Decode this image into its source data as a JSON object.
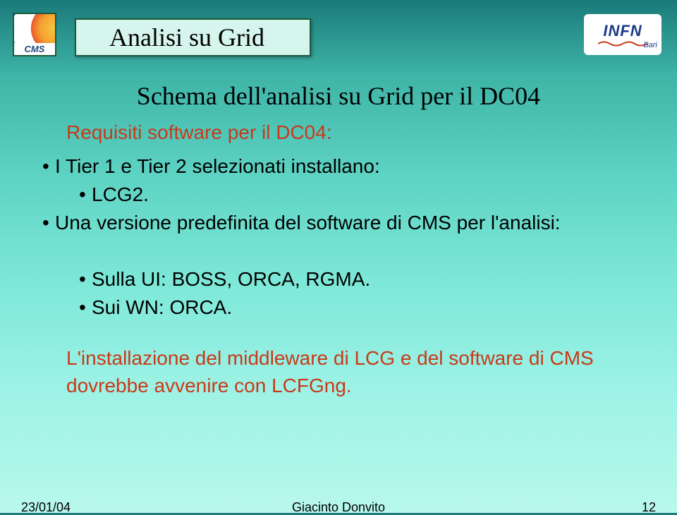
{
  "logos": {
    "cms": "CMS",
    "infn": "INFN",
    "infn_location": "Bari"
  },
  "title": "Analisi su Grid",
  "subtitle": "Schema dell'analisi su Grid per il DC04",
  "section_heading": "Requisiti software per il DC04:",
  "bullets": {
    "b1": "I Tier 1 e Tier 2 selezionati installano:",
    "s1": "LCG2.",
    "b2": "Una versione predefinita del software di CMS per l'analisi:",
    "s2": "Sulla UI: BOSS, ORCA, RGMA.",
    "s3": "Sui WN: ORCA."
  },
  "highlight": "L'installazione del middleware di LCG e del software di CMS dovrebbe avvenire con LCFGng.",
  "footer": {
    "date": "23/01/04",
    "author": "Giacinto Donvito",
    "page": "12"
  }
}
